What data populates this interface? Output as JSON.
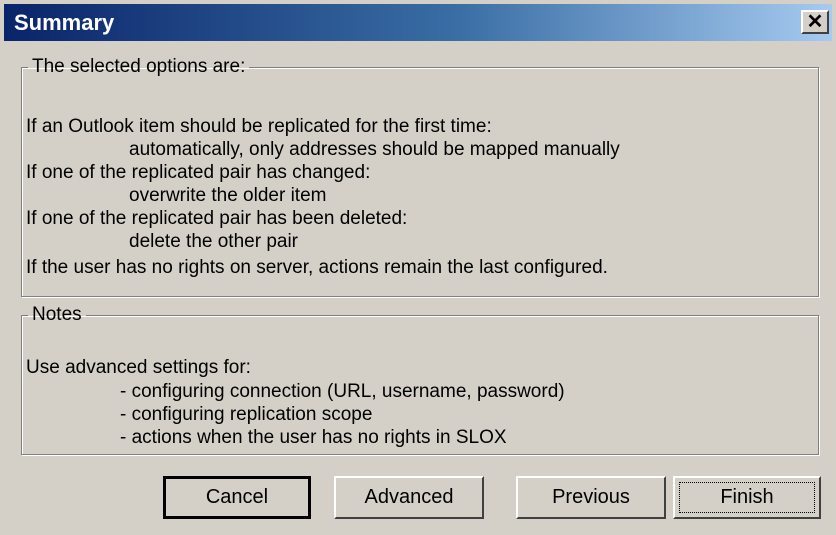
{
  "window": {
    "title": "Summary",
    "close_glyph": "✕"
  },
  "options": {
    "legend": "The selected options are:",
    "lines": [
      "If an Outlook item should be replicated for the first time:",
      "automatically, only addresses should be mapped manually",
      "If one of the replicated pair has changed:",
      "overwrite the older item",
      "If one of the replicated pair has been deleted:",
      "delete  the other pair",
      "If the user has no rights on server, actions remain the last configured."
    ]
  },
  "notes": {
    "legend": "Notes",
    "lines": [
      "Use advanced settings for:",
      "- configuring connection (URL, username, password)",
      "- configuring replication scope",
      "- actions when the user has no rights in SLOX"
    ]
  },
  "buttons": {
    "cancel": "Cancel",
    "advanced": "Advanced",
    "previous": "Previous",
    "finish": "Finish"
  },
  "colors": {
    "face": "#d4d0c8",
    "title_start": "#0a246a",
    "title_end": "#a6caf0"
  }
}
